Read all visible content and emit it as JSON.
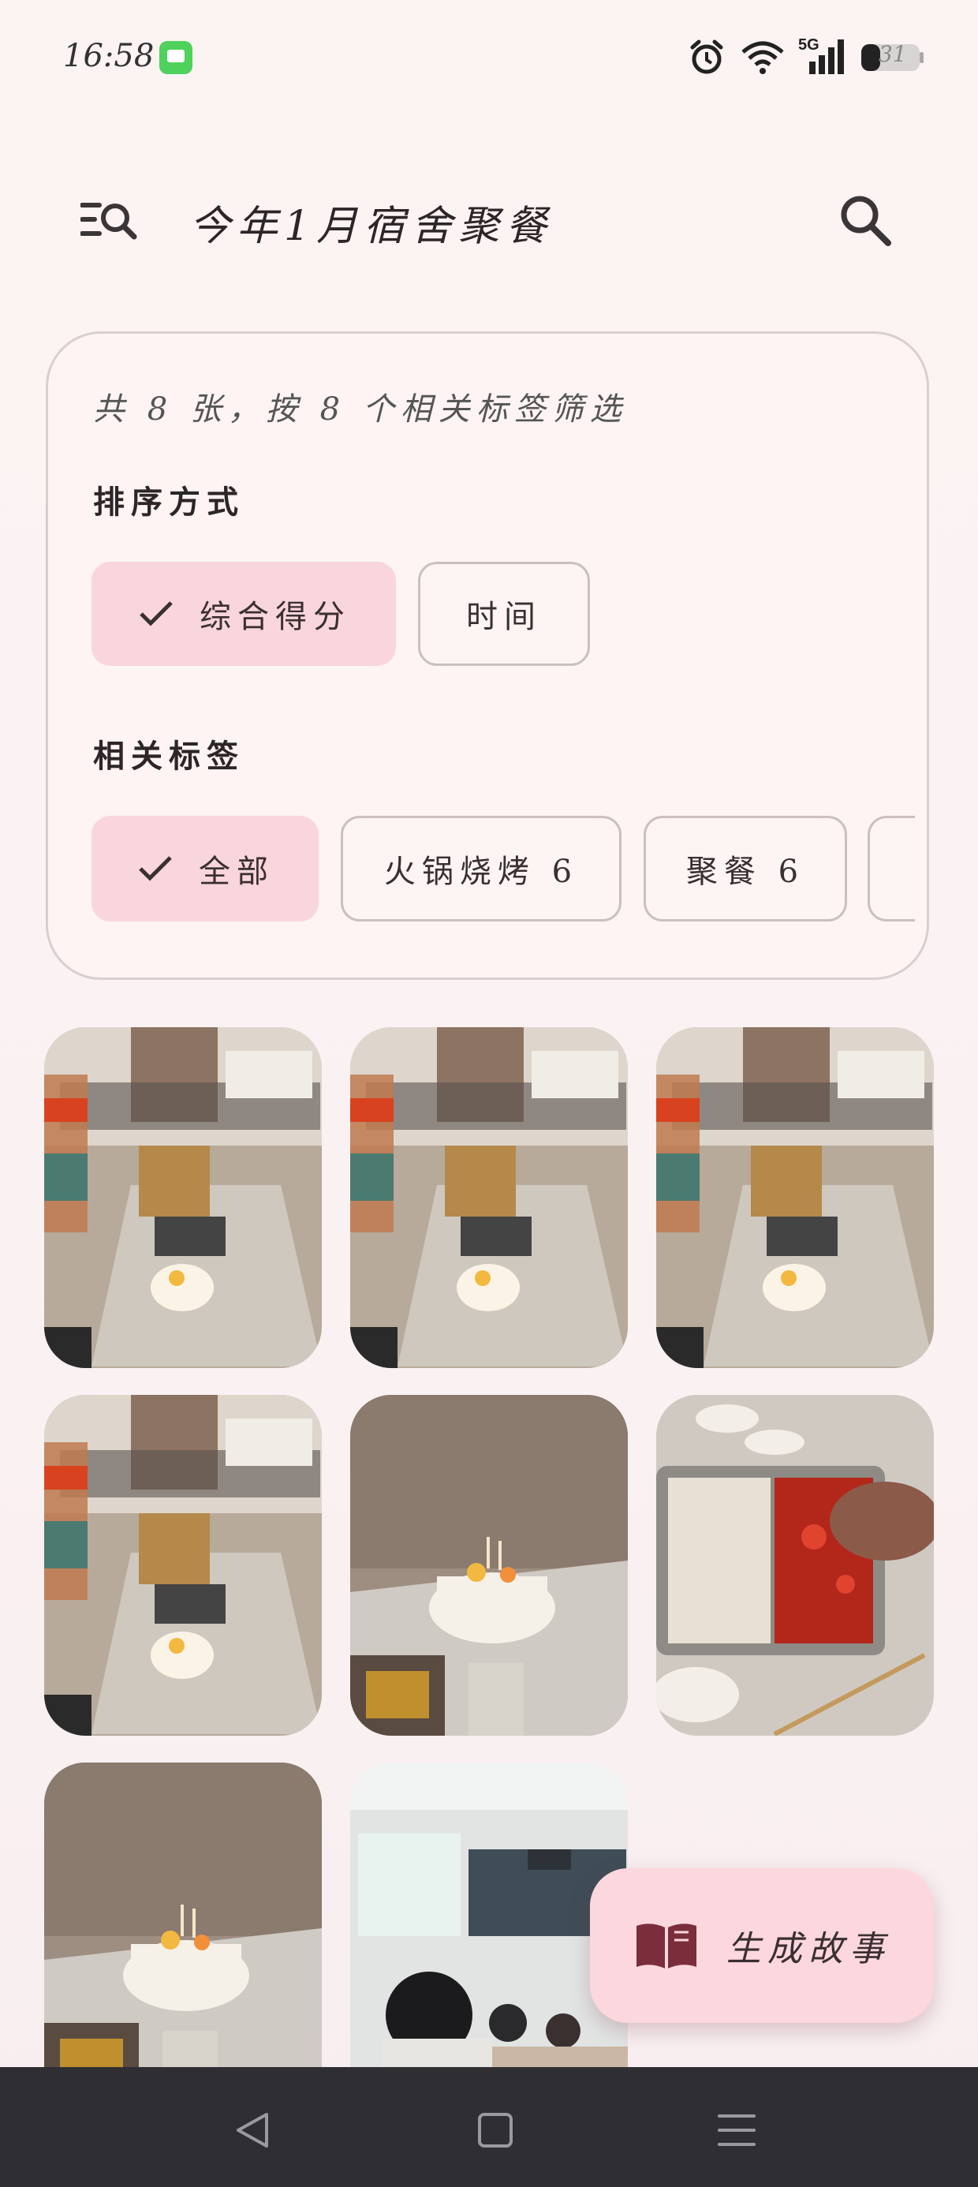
{
  "status_bar": {
    "time": "16:58",
    "battery": "31",
    "network": "5G"
  },
  "header": {
    "title": "今年1月宿舍聚餐"
  },
  "filter": {
    "summary": "共 8 张，按 8 个相关标签筛选",
    "sort_heading": "排序方式",
    "sort_options": [
      {
        "label": "综合得分",
        "selected": true
      },
      {
        "label": "时间",
        "selected": false
      }
    ],
    "tags_heading": "相关标签",
    "tags": [
      {
        "label": "全部",
        "selected": true
      },
      {
        "label": "火锅烧烤 6",
        "selected": false
      },
      {
        "label": "聚餐 6",
        "selected": false
      }
    ]
  },
  "photos": [
    {
      "subject": "group-table-cake"
    },
    {
      "subject": "group-table-cake"
    },
    {
      "subject": "group-table-cake"
    },
    {
      "subject": "group-table-cake"
    },
    {
      "subject": "birthday-cake"
    },
    {
      "subject": "hotpot"
    },
    {
      "subject": "birthday-cake"
    },
    {
      "subject": "classroom"
    }
  ],
  "fab": {
    "label": "生成故事",
    "icon": "book-icon"
  },
  "nav": {
    "icons": [
      "back-icon",
      "home-icon",
      "recents-icon"
    ]
  },
  "colors": {
    "accent": "#f9d6dc",
    "fab": "#fcd7de",
    "fab_icon": "#7a2e3c",
    "nav_bar": "#2f2f33"
  }
}
